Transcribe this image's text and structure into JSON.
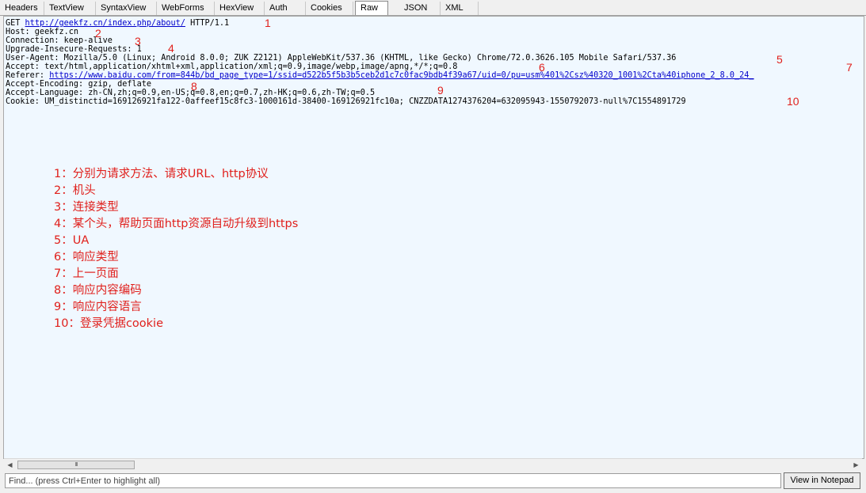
{
  "tabs": [
    {
      "label": "Headers",
      "active": false
    },
    {
      "label": "TextView",
      "active": false
    },
    {
      "label": "SyntaxView",
      "active": false
    },
    {
      "label": "WebForms",
      "active": false
    },
    {
      "label": "HexView",
      "active": false
    },
    {
      "label": "Auth",
      "active": false
    },
    {
      "label": "Cookies",
      "active": false
    },
    {
      "label": "Raw",
      "active": true
    },
    {
      "label": "JSON",
      "active": false
    },
    {
      "label": "XML",
      "active": false
    }
  ],
  "request": {
    "method_prefix": "GET ",
    "url": "http://geekfz.cn/index.php/about/",
    "protocol": " HTTP/1.1",
    "host": "Host: geekfz.cn",
    "connection": "Connection: keep-alive",
    "upgrade": "Upgrade-Insecure-Requests: 1",
    "user_agent": "User-Agent: Mozilla/5.0 (Linux; Android 8.0.0; ZUK Z2121) AppleWebKit/537.36 (KHTML, like Gecko) Chrome/72.0.3626.105 Mobile Safari/537.36",
    "accept": "Accept: text/html,application/xhtml+xml,application/xml;q=0.9,image/webp,image/apng,*/*;q=0.8",
    "referer_prefix": "Referer: ",
    "referer_url": "https://www.baidu.com/from=844b/bd_page_type=1/ssid=d522b5f5b3b5ceb2d1c7c0fac9bdb4f39a67/uid=0/pu=usm%401%2Csz%40320_1001%2Cta%40iphone_2_8.0_24_",
    "accept_encoding": "Accept-Encoding: gzip, deflate",
    "accept_language": "Accept-Language: zh-CN,zh;q=0.9,en-US;q=0.8,en;q=0.7,zh-HK;q=0.6,zh-TW;q=0.5",
    "cookie": "Cookie: UM_distinctid=169126921fa122-0affeef15c8fc3-1000161d-38400-169126921fc10a; CNZZDATA1274376204=632095943-1550792073-null%7C1554891729"
  },
  "markers": [
    "1",
    "2",
    "3",
    "4",
    "5",
    "6",
    "7",
    "8",
    "9",
    "10"
  ],
  "notes": [
    "1：分别为请求方法、请求URL、http协议",
    "2：机头",
    "3：连接类型",
    "4：某个头，帮助页面http资源自动升级到https",
    "5：UA",
    "6：响应类型",
    "7：上一页面",
    "8：响应内容编码",
    "9：响应内容语言",
    "10：登录凭据cookie"
  ],
  "scrollbar": {
    "left_arrow": "◀",
    "right_arrow": "▶",
    "grip": "III"
  },
  "find": {
    "placeholder": "Find... (press Ctrl+Enter to highlight all)",
    "value": ""
  },
  "view_in_notepad_label": "View in Notepad",
  "colors": {
    "annotation": "#e0201c",
    "link": "#0000cc",
    "pane_bg": "#f0f8ff"
  }
}
